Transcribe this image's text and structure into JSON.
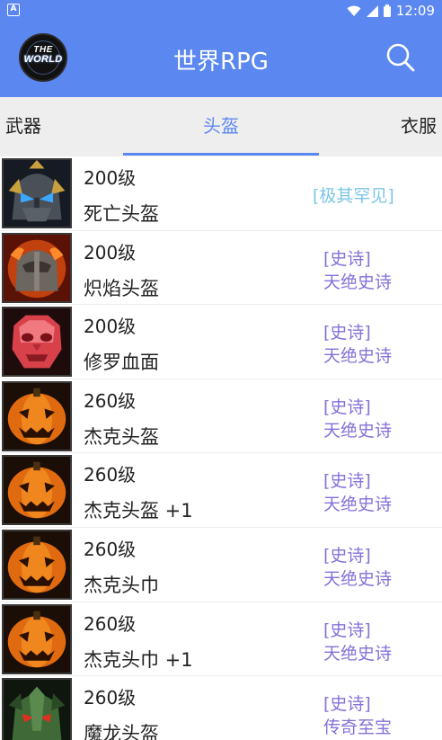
{
  "status_bar": {
    "notification_glyph": "A",
    "time": "12:09",
    "icons": [
      "wifi-icon",
      "signal-icon",
      "battery-icon"
    ]
  },
  "app_bar": {
    "logo_text_top": "THE",
    "logo_text_bottom": "WORLD",
    "title": "世界RPG",
    "accent_color": "#5b87f0"
  },
  "tabs": [
    {
      "label": "武器",
      "selected": false
    },
    {
      "label": "头盔",
      "selected": true
    },
    {
      "label": "衣服",
      "selected": false
    }
  ],
  "items": [
    {
      "level": "200级",
      "name": "死亡头盔",
      "rarity_line1": "[极其罕见]",
      "rarity_line2": "",
      "icon": "death-helmet-icon"
    },
    {
      "level": "200级",
      "name": "炽焰头盔",
      "rarity_line1": "[史诗]",
      "rarity_line2": "天绝史诗",
      "icon": "blaze-helmet-icon"
    },
    {
      "level": "200级",
      "name": "修罗血面",
      "rarity_line1": "[史诗]",
      "rarity_line2": "天绝史诗",
      "icon": "asura-blood-mask-icon"
    },
    {
      "level": "260级",
      "name": "杰克头盔",
      "rarity_line1": "[史诗]",
      "rarity_line2": "天绝史诗",
      "icon": "pumpkin-helmet-icon"
    },
    {
      "level": "260级",
      "name": "杰克头盔 +1",
      "rarity_line1": "[史诗]",
      "rarity_line2": "天绝史诗",
      "icon": "pumpkin-helmet-icon"
    },
    {
      "level": "260级",
      "name": "杰克头巾",
      "rarity_line1": "[史诗]",
      "rarity_line2": "天绝史诗",
      "icon": "pumpkin-headscarf-icon"
    },
    {
      "level": "260级",
      "name": "杰克头巾 +1",
      "rarity_line1": "[史诗]",
      "rarity_line2": "天绝史诗",
      "icon": "pumpkin-headscarf-icon"
    },
    {
      "level": "260级",
      "name": "魔龙头盔",
      "rarity_line1": "[史诗]",
      "rarity_line2": "传奇至宝",
      "icon": "dragon-helmet-icon"
    }
  ]
}
